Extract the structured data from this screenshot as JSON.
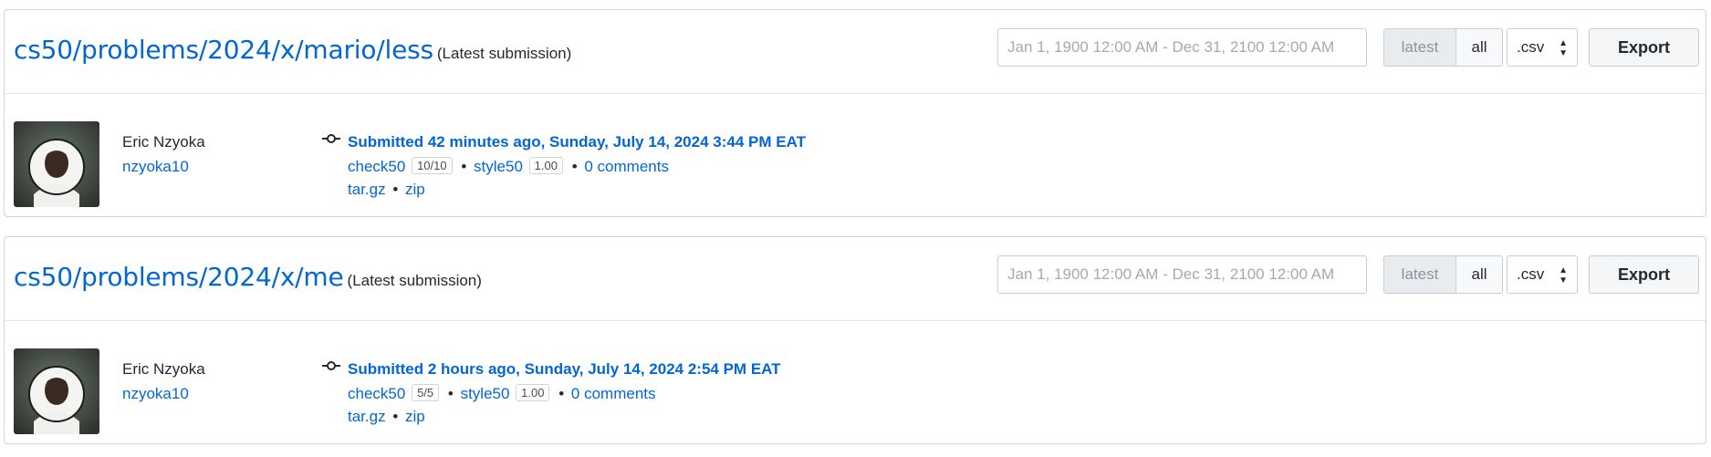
{
  "filter": {
    "date_placeholder": "Jan 1, 1900 12:00 AM - Dec 31, 2100 12:00 AM",
    "latest_label": "latest",
    "all_label": "all",
    "format_value": ".csv",
    "export_label": "Export"
  },
  "cards": [
    {
      "title": "cs50/problems/2024/x/mario/less",
      "subtitle": "(Latest submission)",
      "user_name": "Eric Nzyoka",
      "user_handle": "nzyoka10",
      "submitted": "Submitted 42 minutes ago, Sunday, July 14, 2024 3:44 PM EAT",
      "check50_label": "check50",
      "check50_score": "10/10",
      "style50_label": "style50",
      "style50_score": "1.00",
      "comments": "0 comments",
      "targz": "tar.gz",
      "zip": "zip"
    },
    {
      "title": "cs50/problems/2024/x/me",
      "subtitle": "(Latest submission)",
      "user_name": "Eric Nzyoka",
      "user_handle": "nzyoka10",
      "submitted": "Submitted 2 hours ago, Sunday, July 14, 2024 2:54 PM EAT",
      "check50_label": "check50",
      "check50_score": "5/5",
      "style50_label": "style50",
      "style50_score": "1.00",
      "comments": "0 comments",
      "targz": "tar.gz",
      "zip": "zip"
    }
  ],
  "separator": "•",
  "icons": {
    "commit": "git-commit-icon",
    "avatar": "user-avatar",
    "select_caret": "sort-caret-icon"
  }
}
